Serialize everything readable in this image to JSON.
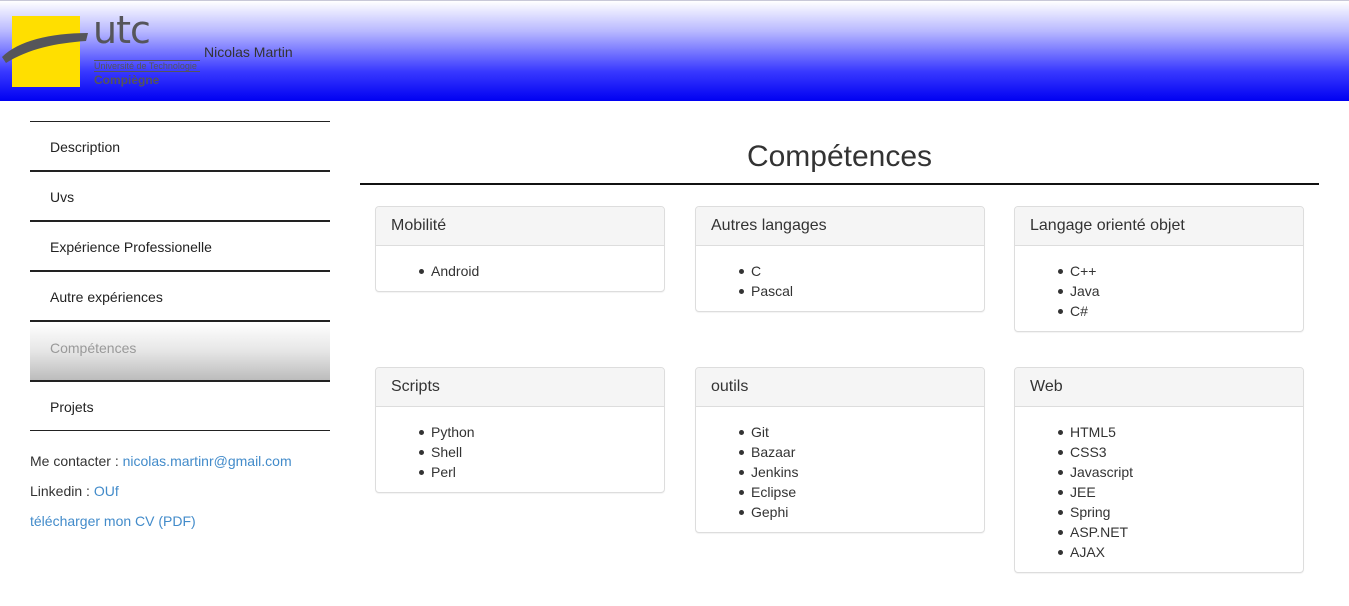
{
  "header": {
    "logo": {
      "brand": "utc",
      "line1": "Université de Technologie",
      "line2": "Compiègne",
      "colors": {
        "square": "#ffdf00",
        "text": "#55555a"
      }
    },
    "name": "Nicolas Martin",
    "gradient": [
      "#ffffff",
      "#0000f2"
    ]
  },
  "sidebar": {
    "items": [
      {
        "label": "Description",
        "active": false
      },
      {
        "label": "Uvs",
        "active": false
      },
      {
        "label": "Expérience Professionelle",
        "active": false
      },
      {
        "label": "Autre expériences",
        "active": false
      },
      {
        "label": "Compétences",
        "active": true
      },
      {
        "label": "Projets",
        "active": false
      }
    ],
    "contact": {
      "contact_label": "Me contacter : ",
      "email": "nicolas.martinr@gmail.com",
      "linkedin_label": "Linkedin : ",
      "linkedin_link": "OUf",
      "cv_link": "télécharger mon CV (PDF)"
    }
  },
  "main": {
    "title": "Compétences",
    "panels": [
      {
        "title": "Mobilité",
        "items": [
          "Android"
        ]
      },
      {
        "title": "Autres langages",
        "items": [
          "C",
          "Pascal"
        ]
      },
      {
        "title": "Langage orienté objet",
        "items": [
          "C++",
          "Java",
          "C#"
        ]
      },
      {
        "title": "Scripts",
        "items": [
          "Python",
          "Shell",
          "Perl"
        ]
      },
      {
        "title": "outils",
        "items": [
          "Git",
          "Bazaar",
          "Jenkins",
          "Eclipse",
          "Gephi"
        ]
      },
      {
        "title": "Web",
        "items": [
          "HTML5",
          "CSS3",
          "Javascript",
          "JEE",
          "Spring",
          "ASP.NET",
          "AJAX"
        ]
      }
    ]
  },
  "colors": {
    "link": "#428bca",
    "panel_heading_bg": "#f5f5f5",
    "panel_border": "#dddddd"
  }
}
